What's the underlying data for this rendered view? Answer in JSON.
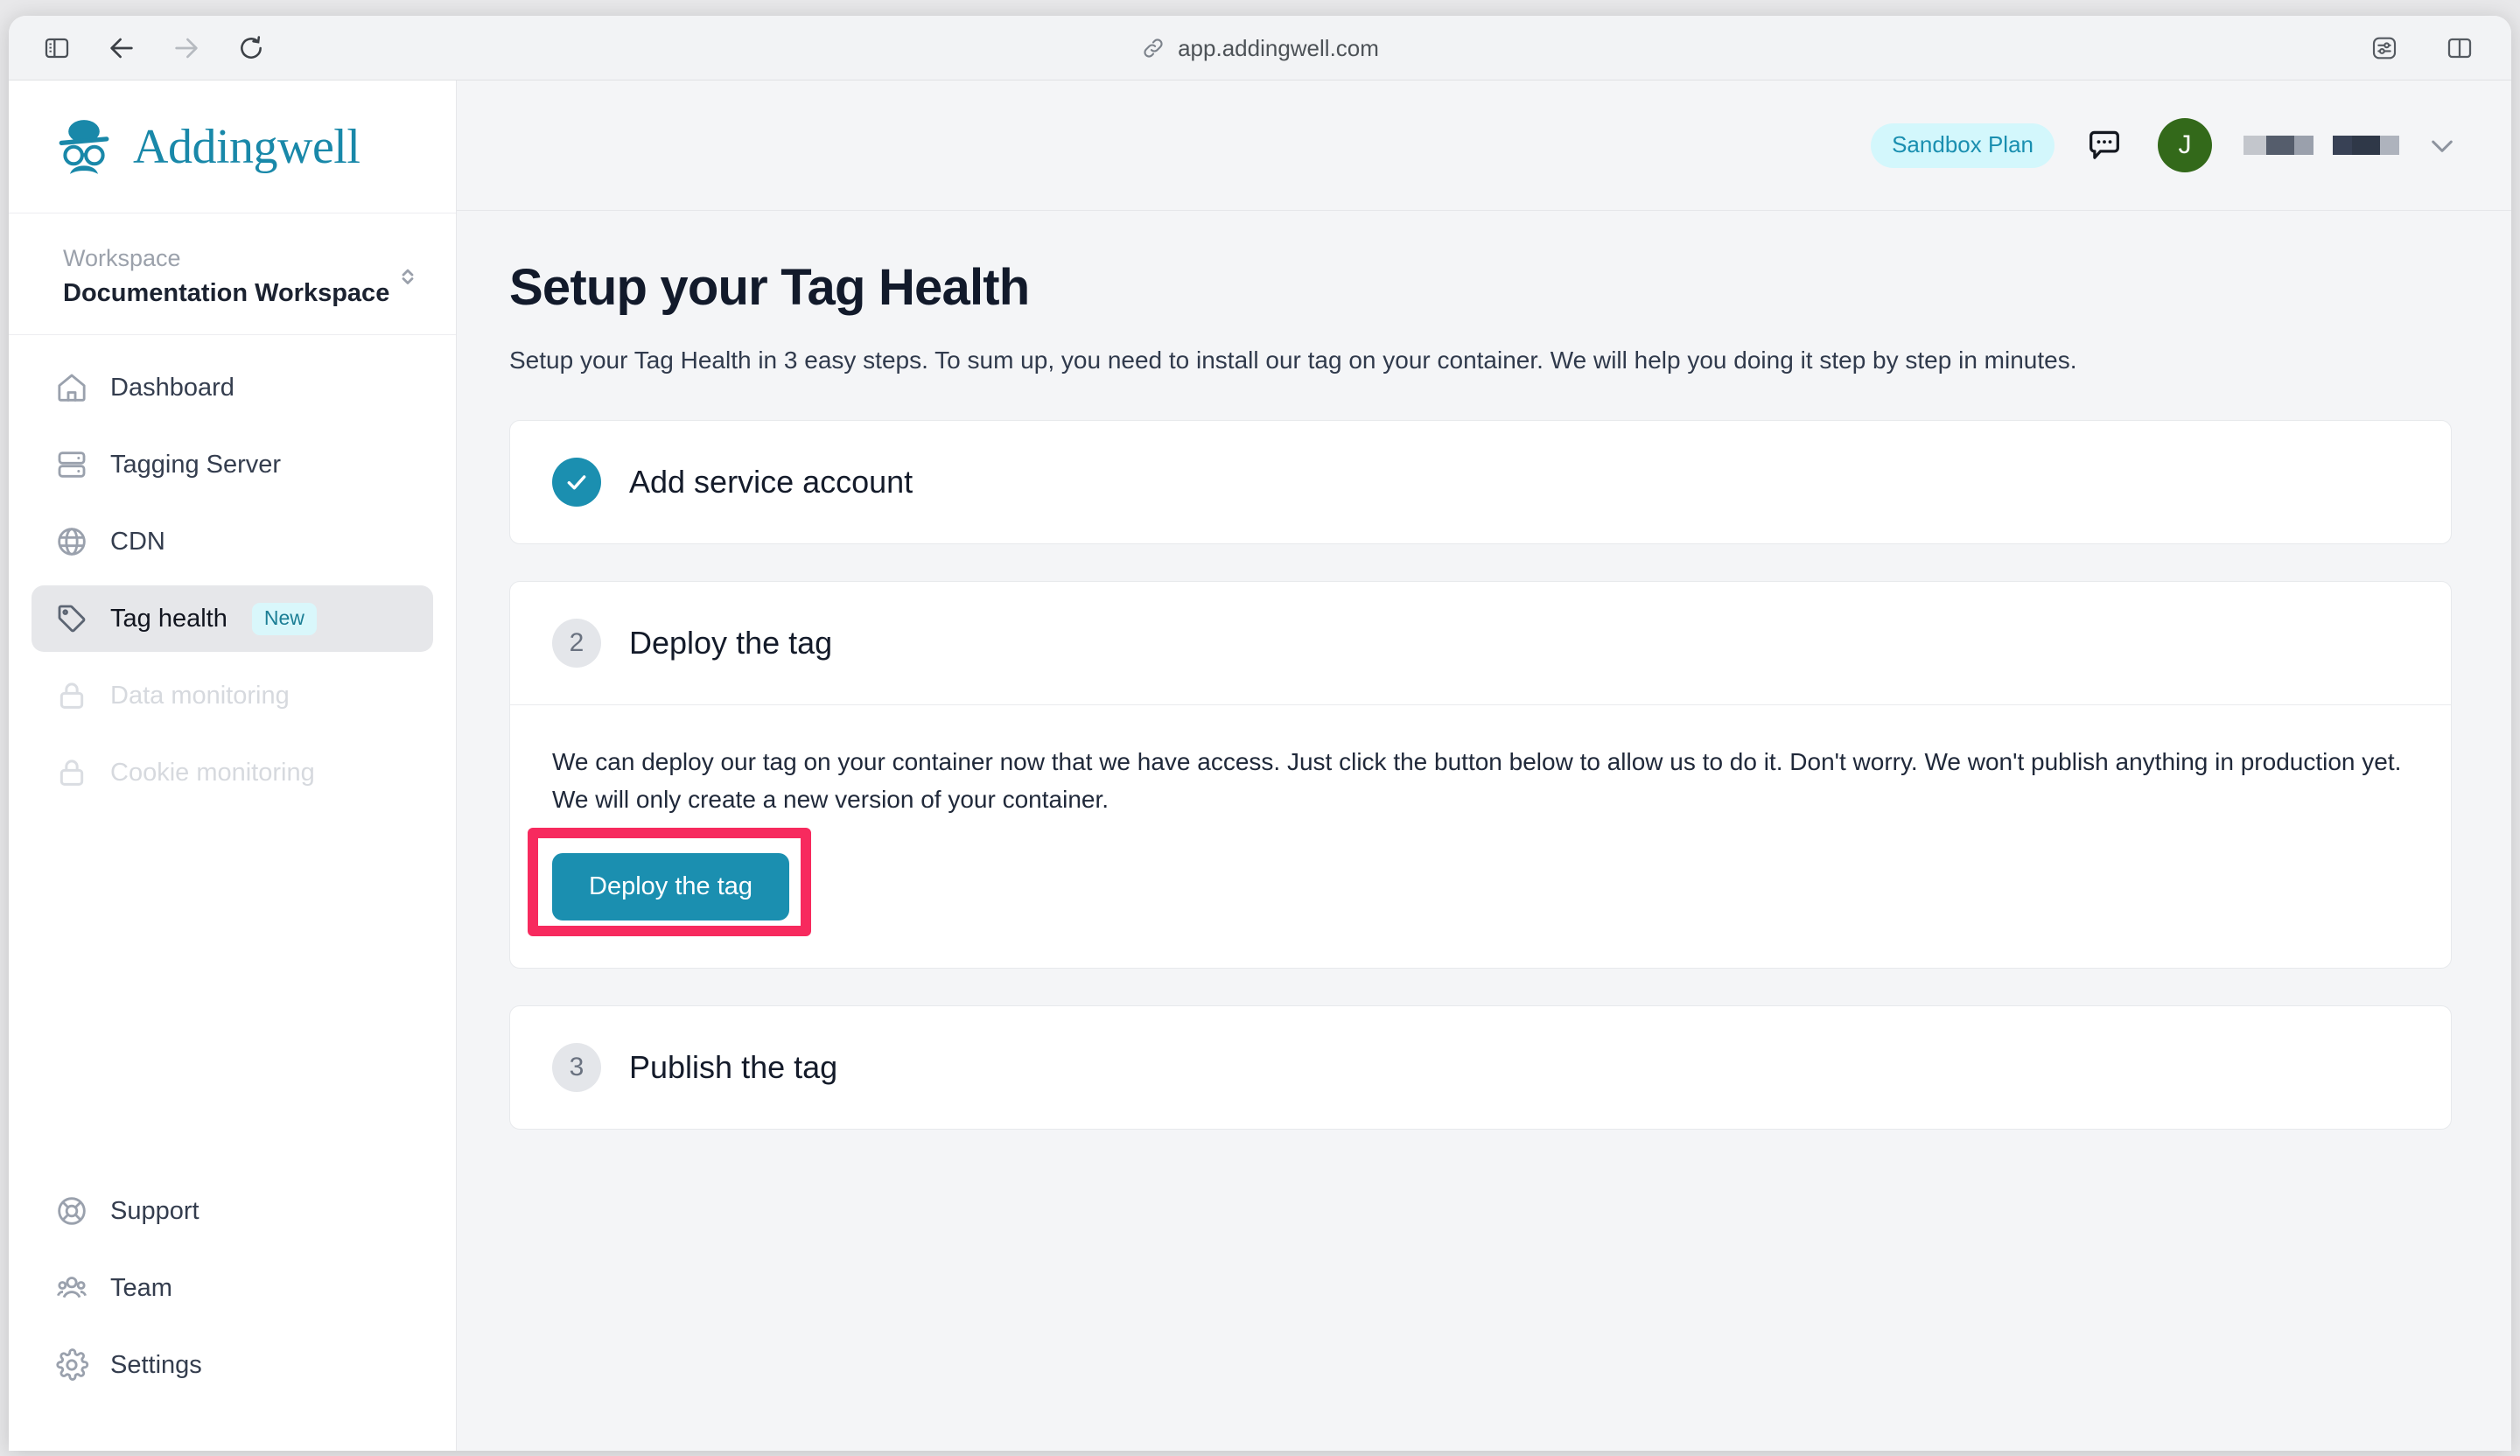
{
  "browser": {
    "url": "app.addingwell.com",
    "toolbar_left": [
      {
        "name": "sidebar-toggle",
        "icon": "sidebar-toggle-icon"
      },
      {
        "name": "back",
        "icon": "back-arrow-icon"
      },
      {
        "name": "forward",
        "icon": "forward-arrow-icon"
      },
      {
        "name": "reload",
        "icon": "reload-icon"
      }
    ],
    "toolbar_right": [
      {
        "name": "page-settings",
        "icon": "sliders-icon"
      },
      {
        "name": "split-view",
        "icon": "split-view-icon"
      }
    ],
    "url_icon": "link-icon"
  },
  "sidebar": {
    "logo": {
      "word": "Addingwell",
      "icon": "addingwell-gentleman-icon",
      "color": "#1988a9"
    },
    "workspace": {
      "label": "Workspace",
      "name": "Documentation Workspace",
      "selector_icon": "chevron-up-down-icon"
    },
    "nav": [
      {
        "label": "Dashboard",
        "icon": "home-icon",
        "state": "default",
        "badge": ""
      },
      {
        "label": "Tagging Server",
        "icon": "server-icon",
        "state": "default",
        "badge": ""
      },
      {
        "label": "CDN",
        "icon": "globe-icon",
        "state": "default",
        "badge": ""
      },
      {
        "label": "Tag health",
        "icon": "tag-icon",
        "state": "active",
        "badge": "New"
      },
      {
        "label": "Data monitoring",
        "icon": "lock-icon",
        "state": "disabled",
        "badge": ""
      },
      {
        "label": "Cookie monitoring",
        "icon": "lock-icon",
        "state": "disabled",
        "badge": ""
      }
    ],
    "nav_bottom": [
      {
        "label": "Support",
        "icon": "lifebuoy-icon",
        "state": "default",
        "badge": ""
      },
      {
        "label": "Team",
        "icon": "people-icon",
        "state": "default",
        "badge": ""
      },
      {
        "label": "Settings",
        "icon": "gear-icon",
        "state": "default",
        "badge": ""
      }
    ]
  },
  "topbar": {
    "plan_badge": "Sandbox Plan",
    "chat_icon": "chat-bubble-icon",
    "avatar_initial": "J",
    "avatar_color": "#33691a",
    "chevron_icon": "chevron-down-icon",
    "redacted_name_blocks": [
      {
        "colors": [
          "#c3c6cc",
          "#555d6c",
          "#9aa0ac"
        ]
      },
      {
        "colors": [
          "#384155",
          "#384155",
          "#aeb3bd"
        ]
      }
    ]
  },
  "main": {
    "title": "Setup your Tag Health",
    "subtitle": "Setup your Tag Health in 3 easy steps. To sum up, you need to install our tag on your container. We will help you doing it step by step in minutes.",
    "steps": [
      {
        "number": "1",
        "marker": "check",
        "title": "Add service account",
        "body": "",
        "button": ""
      },
      {
        "number": "2",
        "marker": "number",
        "title": "Deploy the tag",
        "body": "We can deploy our tag on your container now that we have access. Just click the button below to allow us to do it. Don't worry. We won't publish anything in production yet. We will only create a new version of your container.",
        "button": "Deploy the tag"
      },
      {
        "number": "3",
        "marker": "number",
        "title": "Publish the tag",
        "body": "",
        "button": ""
      }
    ]
  },
  "annotation": {
    "target": "deploy-the-tag-button",
    "color": "#f72a5e"
  },
  "colors": {
    "brand_teal": "#1b8fb0",
    "accent_pink": "#f72a5e",
    "badge_cyan_bg": "#d3f7fc",
    "page_bg": "#f4f5f7"
  }
}
